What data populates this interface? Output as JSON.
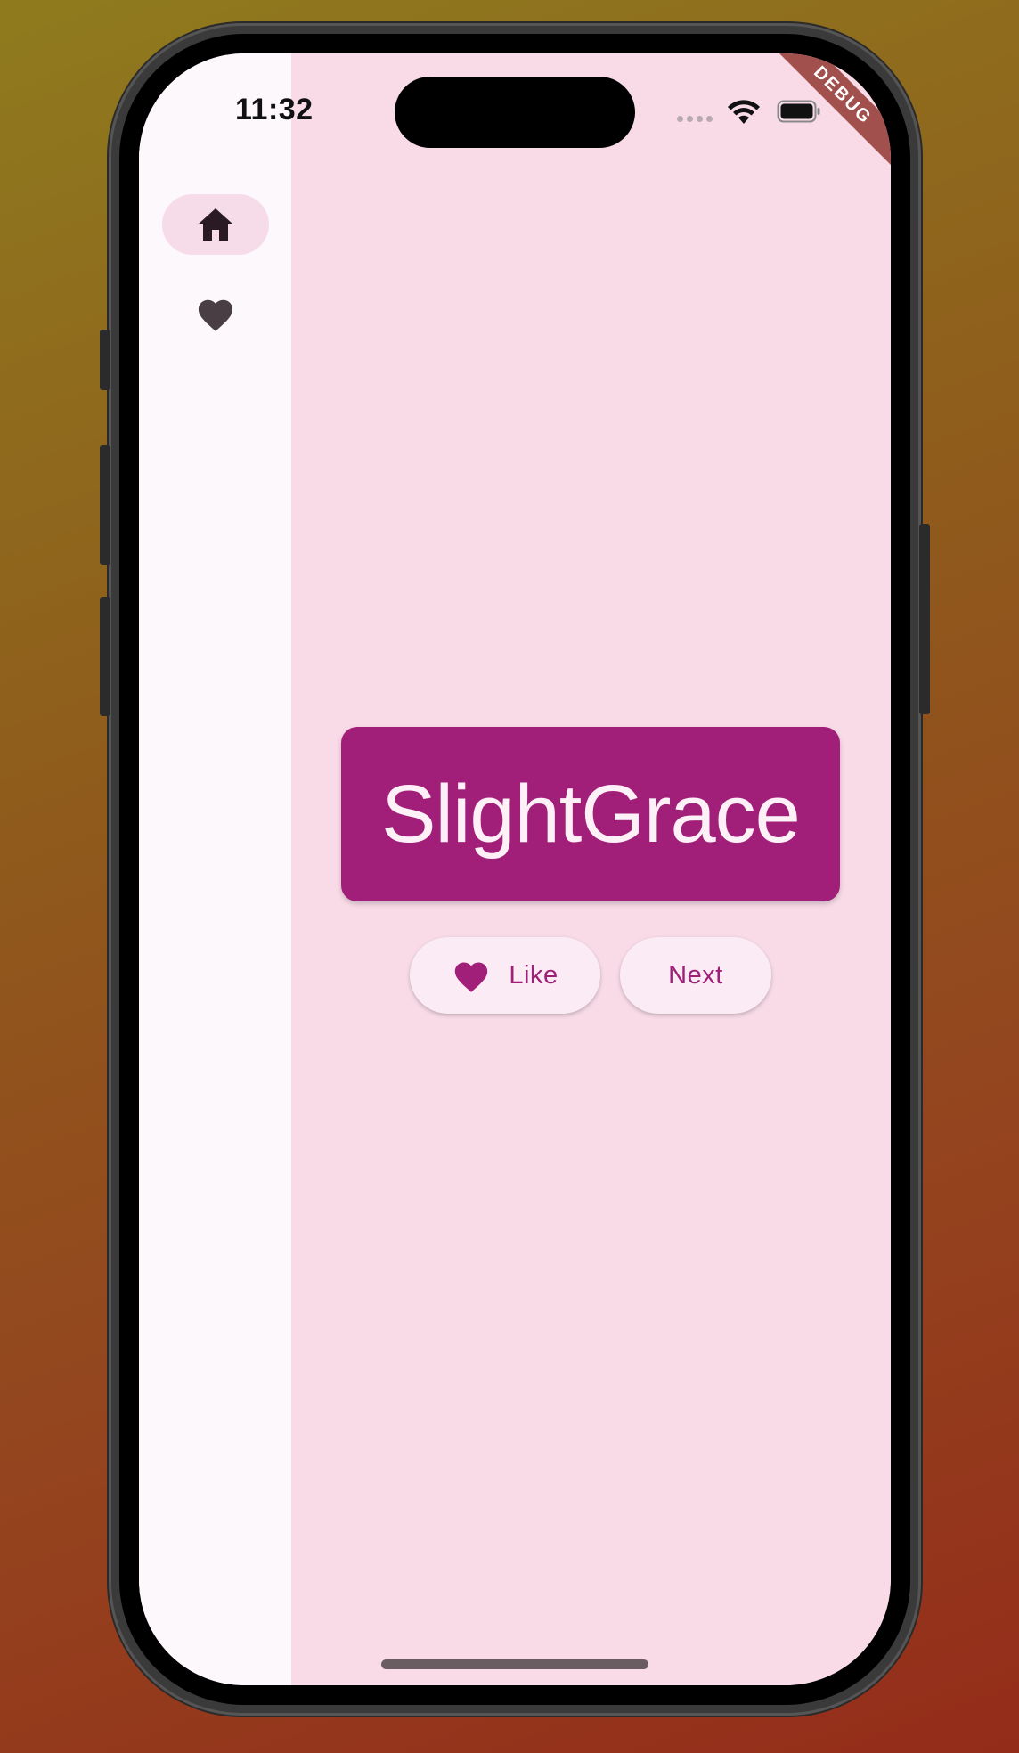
{
  "status_bar": {
    "time": "11:32"
  },
  "debug_banner": "DEBUG",
  "nav_rail": {
    "items": [
      {
        "name": "home",
        "icon": "home-icon",
        "selected": true
      },
      {
        "name": "favorites",
        "icon": "heart-icon",
        "selected": false
      }
    ]
  },
  "main": {
    "word": "SlightGrace",
    "like_label": "Like",
    "next_label": "Next"
  },
  "colors": {
    "primary": "#a21f79",
    "background": "#f8dbe7",
    "rail_background": "#fdf8fc",
    "button_background": "#fbebf4",
    "debug_ribbon": "#a2504d"
  }
}
